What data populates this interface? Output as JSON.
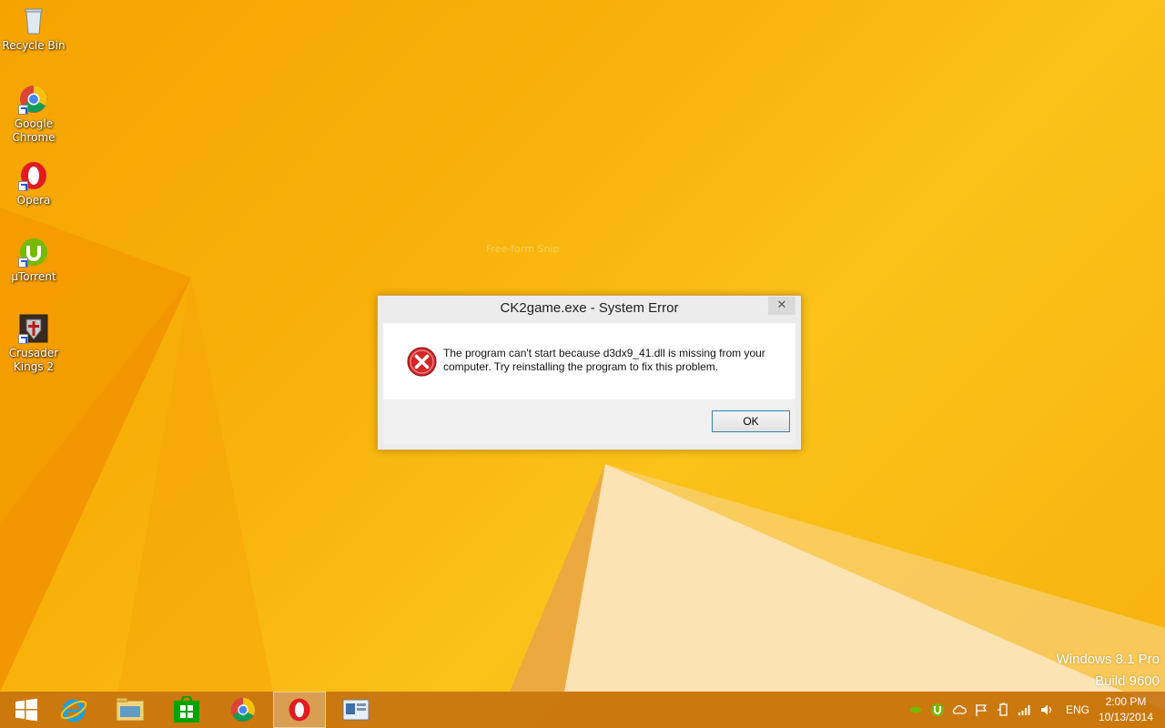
{
  "desktop": {
    "icons": [
      {
        "label": "Recycle Bin",
        "icon": "recycle-bin-icon"
      },
      {
        "label": "Google Chrome",
        "icon": "chrome-icon"
      },
      {
        "label": "Opera",
        "icon": "opera-icon"
      },
      {
        "label": "µTorrent",
        "icon": "utorrent-icon"
      },
      {
        "label": "Crusader Kings 2",
        "icon": "crusader-kings-icon"
      }
    ],
    "watermark": "Free-form Snip",
    "os_name": "Windows 8.1 Pro",
    "os_build": "Build 9600"
  },
  "dialog": {
    "title": "CK2game.exe - System Error",
    "close_label": "✕",
    "message": "The program can't start because d3dx9_41.dll is missing from your computer. Try reinstalling the program to fix this problem.",
    "ok_label": "OK",
    "icon": "error-icon"
  },
  "taskbar": {
    "items": [
      {
        "name": "start-button",
        "icon": "windows-logo-icon"
      },
      {
        "name": "internet-explorer",
        "icon": "internet-explorer-icon"
      },
      {
        "name": "file-explorer",
        "icon": "file-explorer-icon"
      },
      {
        "name": "store",
        "icon": "store-icon"
      },
      {
        "name": "chrome",
        "icon": "chrome-icon"
      },
      {
        "name": "opera",
        "icon": "opera-icon",
        "active": true
      },
      {
        "name": "snipping-tool",
        "icon": "snipping-tool-icon"
      }
    ],
    "tray": {
      "language": "ENG",
      "time": "2:00 PM",
      "date": "10/13/2014"
    }
  },
  "colors": {
    "accent": "#f7b10c",
    "taskbar": "#c4700e",
    "error_red": "#d42727"
  }
}
